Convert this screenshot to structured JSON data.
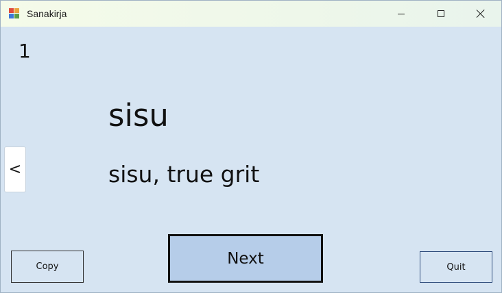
{
  "window": {
    "title": "Sanakirja"
  },
  "card": {
    "index": "1",
    "word": "sisu",
    "translation": "sisu, true grit"
  },
  "nav": {
    "prev_label": "<"
  },
  "buttons": {
    "copy_label": "Copy",
    "next_label": "Next",
    "quit_label": "Quit"
  },
  "icons": {
    "app": "app-icon",
    "minimize": "minimize-icon",
    "maximize": "maximize-icon",
    "close": "close-icon"
  },
  "colors": {
    "background": "#d6e4f2",
    "next_button_fill": "#b6cde9",
    "titlebar": "#f0f8ea"
  }
}
